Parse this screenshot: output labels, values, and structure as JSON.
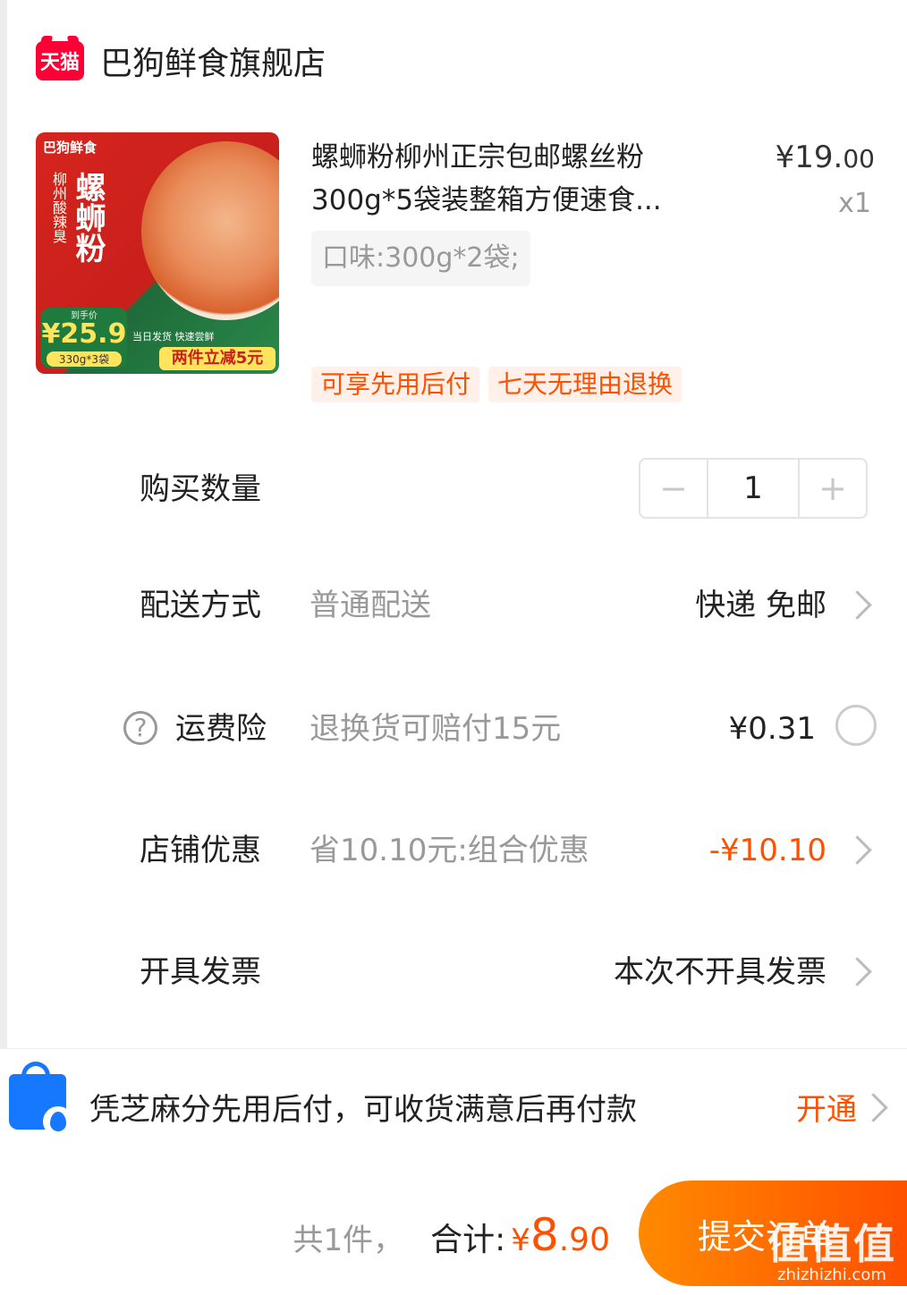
{
  "shop": {
    "logo_text": "天猫",
    "name": "巴狗鲜食旗舰店"
  },
  "product": {
    "image": {
      "brand": "巴狗鲜食",
      "big_text": "螺蛳粉",
      "side_text": "柳州酸辣臭",
      "price_label": "到手价",
      "price": "¥25.9",
      "spec": "330g*3袋",
      "ribbon": "当日发货 快速尝鲜",
      "promo": "两件立减5元"
    },
    "title_line1": "螺蛳粉柳州正宗包邮螺丝粉",
    "title_line2": "300g*5袋装整箱方便速食...",
    "price_currency": "¥",
    "price_int": "19.",
    "price_cents": "00",
    "quantity_label": "x1",
    "sku": "口味:300g*2袋;",
    "tags": [
      "可享先用后付",
      "七天无理由退换"
    ]
  },
  "order": {
    "quantity": {
      "label": "购买数量",
      "value": "1",
      "minus": "−",
      "plus": "+"
    },
    "shipping": {
      "label": "配送方式",
      "sub": "普通配送",
      "value": "快递 免邮"
    },
    "insurance": {
      "label": "运费险",
      "sub": "退换货可赔付15元",
      "value": "¥0.31",
      "help": "?"
    },
    "discount": {
      "label": "店铺优惠",
      "sub": "省10.10元:组合优惠",
      "value": "-¥10.10"
    },
    "invoice": {
      "label": "开具发票",
      "value": "本次不开具发票"
    }
  },
  "bnpl": {
    "text": "凭芝麻分先用后付，可收货满意后再付款",
    "action": "开通"
  },
  "footer": {
    "count": "共1件，",
    "total_label": "合计:",
    "currency": "¥",
    "total_int": "8",
    "total_dec": ".90",
    "submit": "提交订单"
  },
  "watermark": {
    "big": "值值值",
    "small": "zhizhizhi.com"
  },
  "colors": {
    "accent": "#ff5000",
    "tmall": "#ff0036",
    "alipay": "#1677ff"
  }
}
